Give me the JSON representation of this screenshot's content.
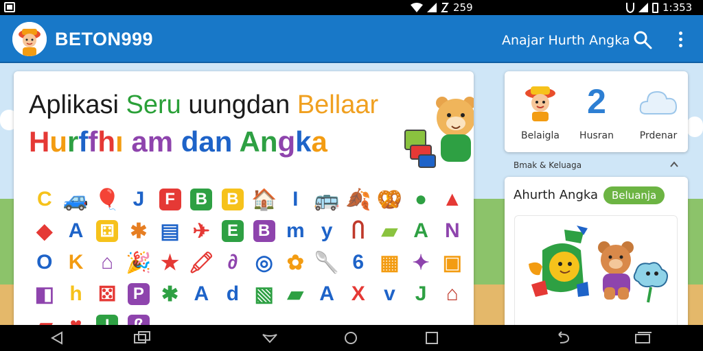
{
  "status_bar": {
    "network_time": "259",
    "clock": "1:353"
  },
  "app_bar": {
    "title": "BETON999",
    "subtitle": "Anajar Hurth Angka",
    "icons": [
      "search-icon",
      "more-vert-icon"
    ]
  },
  "main": {
    "headline_line1": [
      {
        "text": "Aplikasi ",
        "color": "#1b1b1b"
      },
      {
        "text": "Seru ",
        "color": "#2aa038"
      },
      {
        "text": "uungdan ",
        "color": "#1b1b1b"
      },
      {
        "text": "Bellaar",
        "color": "#f0a020"
      }
    ],
    "headline_line2": [
      {
        "text": "H",
        "color": "#e53935"
      },
      {
        "text": "u",
        "color": "#f39c12"
      },
      {
        "text": "r",
        "color": "#2ea043"
      },
      {
        "text": "f",
        "color": "#1e63c8"
      },
      {
        "text": "f",
        "color": "#8e44ad"
      },
      {
        "text": "h",
        "color": "#e53935"
      },
      {
        "text": "ı ",
        "color": "#f39c12"
      },
      {
        "text": "am ",
        "color": "#8e44ad"
      },
      {
        "text": "dan ",
        "color": "#1e63c8"
      },
      {
        "text": "A",
        "color": "#2ea043"
      },
      {
        "text": "n",
        "color": "#2ea043"
      },
      {
        "text": "g",
        "color": "#8e44ad"
      },
      {
        "text": "k",
        "color": "#1e63c8"
      },
      {
        "text": "a",
        "color": "#f39c12"
      }
    ],
    "grid_items": [
      {
        "t": "C",
        "k": "letter",
        "c": "#f6c21b",
        "n": "letter-c"
      },
      {
        "t": "🚙",
        "k": "sym",
        "c": "#1e63c8",
        "n": "car-icon"
      },
      {
        "t": "🎈",
        "k": "sym",
        "c": "#e53935",
        "n": "balloon-icon"
      },
      {
        "t": "J",
        "k": "letter",
        "c": "#1e63c8",
        "n": "letter-j"
      },
      {
        "t": "F",
        "k": "tile",
        "c": "#e53935",
        "n": "letter-f-block"
      },
      {
        "t": "B",
        "k": "tile",
        "c": "#2ea043",
        "n": "letter-b-block"
      },
      {
        "t": "B",
        "k": "tile",
        "c": "#f6c21b",
        "n": "letter-b-block"
      },
      {
        "t": "🏠",
        "k": "sym",
        "c": "#c0392b",
        "n": "house-icon"
      },
      {
        "t": "I",
        "k": "letter",
        "c": "#1e63c8",
        "n": "letter-i"
      },
      {
        "t": "🚌",
        "k": "sym",
        "c": "#f39c12",
        "n": "bus-icon"
      },
      {
        "t": "🍂",
        "k": "sym",
        "c": "#f39c12",
        "n": "hat-icon"
      },
      {
        "t": "🥨",
        "k": "sym",
        "c": "#f6c21b",
        "n": "pretzel-icon"
      },
      {
        "t": "●",
        "k": "sym",
        "c": "#2ea043",
        "n": "ball-icon"
      },
      {
        "t": "▲",
        "k": "sym",
        "c": "#e53935",
        "n": "arrow-icon"
      },
      {
        "t": "◆",
        "k": "sym",
        "c": "#e53935",
        "n": "kite-icon"
      },
      {
        "t": "A",
        "k": "letter",
        "c": "#1e63c8",
        "n": "letter-a"
      },
      {
        "t": "⚃",
        "k": "tile",
        "c": "#f6c21b",
        "n": "dice-icon"
      },
      {
        "t": "✱",
        "k": "sym",
        "c": "#e67e22",
        "n": "flower-icon"
      },
      {
        "t": "▤",
        "k": "sym",
        "c": "#1e63c8",
        "n": "ruler-icon"
      },
      {
        "t": "✈",
        "k": "sym",
        "c": "#e53935",
        "n": "plane-icon"
      },
      {
        "t": "E",
        "k": "tile",
        "c": "#2ea043",
        "n": "letter-e-block"
      },
      {
        "t": "B",
        "k": "tile",
        "c": "#8e44ad",
        "n": "letter-b-block"
      },
      {
        "t": "m",
        "k": "letter",
        "c": "#1e63c8",
        "n": "letter-m"
      },
      {
        "t": "y",
        "k": "letter",
        "c": "#1e63c8",
        "n": "letter-y"
      },
      {
        "t": "Ⴖ",
        "k": "sym",
        "c": "#c0392b",
        "n": "gate-icon"
      },
      {
        "t": "▰",
        "k": "sym",
        "c": "#8ac33f",
        "n": "ruler-icon"
      },
      {
        "t": "A",
        "k": "letter",
        "c": "#2ea043",
        "n": "letter-a"
      },
      {
        "t": "N",
        "k": "letter",
        "c": "#8e44ad",
        "n": "letter-n"
      },
      {
        "t": "O",
        "k": "letter",
        "c": "#1e63c8",
        "n": "letter-o"
      },
      {
        "t": "K",
        "k": "letter",
        "c": "#f39c12",
        "n": "letter-k"
      },
      {
        "t": "⌂",
        "k": "sym",
        "c": "#8e44ad",
        "n": "house-icon"
      },
      {
        "t": "🎉",
        "k": "sym",
        "c": "#e53935",
        "n": "party-icon"
      },
      {
        "t": "★",
        "k": "sym",
        "c": "#e53935",
        "n": "star-icon"
      },
      {
        "t": "🖍",
        "k": "sym",
        "c": "#e53935",
        "n": "crayon-icon"
      },
      {
        "t": "∂",
        "k": "sym",
        "c": "#8e44ad",
        "n": "toy-icon"
      },
      {
        "t": "◎",
        "k": "sym",
        "c": "#1e63c8",
        "n": "target-icon"
      },
      {
        "t": "✿",
        "k": "sym",
        "c": "#f39c12",
        "n": "flower-icon"
      },
      {
        "t": "🥄",
        "k": "sym",
        "c": "#f39c12",
        "n": "spoon-icon"
      },
      {
        "t": "6",
        "k": "letter",
        "c": "#1e63c8",
        "n": "number-6"
      },
      {
        "t": "▦",
        "k": "sym",
        "c": "#f39c12",
        "n": "box-icon"
      },
      {
        "t": "✦",
        "k": "sym",
        "c": "#8e44ad",
        "n": "sparkle-icon"
      },
      {
        "t": "▣",
        "k": "sym",
        "c": "#f39c12",
        "n": "crate-icon"
      },
      {
        "t": "◧",
        "k": "sym",
        "c": "#8e44ad",
        "n": "cube-icon"
      },
      {
        "t": "h",
        "k": "letter",
        "c": "#f6c21b",
        "n": "letter-h"
      },
      {
        "t": "⚄",
        "k": "sym",
        "c": "#e53935",
        "n": "dice-icon"
      },
      {
        "t": "P",
        "k": "tile",
        "c": "#8e44ad",
        "n": "letter-p-block"
      },
      {
        "t": "✱",
        "k": "sym",
        "c": "#2ea043",
        "n": "flower-icon"
      },
      {
        "t": "A",
        "k": "letter",
        "c": "#1e63c8",
        "n": "letter-a"
      },
      {
        "t": "d",
        "k": "letter",
        "c": "#1e63c8",
        "n": "letter-d"
      },
      {
        "t": "▧",
        "k": "sym",
        "c": "#2ea043",
        "n": "toy-box-icon"
      },
      {
        "t": "▰",
        "k": "sym",
        "c": "#2ea043",
        "n": "ruler-icon"
      },
      {
        "t": "A",
        "k": "letter",
        "c": "#1e63c8",
        "n": "letter-a"
      },
      {
        "t": "X",
        "k": "letter",
        "c": "#e53935",
        "n": "letter-x"
      },
      {
        "t": "v",
        "k": "letter",
        "c": "#1e63c8",
        "n": "letter-v"
      },
      {
        "t": "J",
        "k": "letter",
        "c": "#2ea043",
        "n": "letter-j"
      },
      {
        "t": "⌂",
        "k": "sym",
        "c": "#c0392b",
        "n": "house-icon"
      },
      {
        "t": "▰",
        "k": "sym",
        "c": "#e53935",
        "n": "ruler-icon"
      },
      {
        "t": "♥",
        "k": "sym",
        "c": "#e53935",
        "n": "heart-icon"
      },
      {
        "t": "I",
        "k": "tile",
        "c": "#2ea043",
        "n": "letter-i-block"
      },
      {
        "t": "ß",
        "k": "tile",
        "c": "#8e44ad",
        "n": "letter-block"
      }
    ]
  },
  "categories": [
    {
      "label": "Belaigla",
      "icon": "child-icon"
    },
    {
      "label": "Husran",
      "number": "2",
      "icon": "number-two-icon"
    },
    {
      "label": "Prdenar",
      "icon": "cloud-icon"
    }
  ],
  "section_header": {
    "label": "Bmak & Keluaga",
    "icon": "chevron-up-icon"
  },
  "feature": {
    "title": "Ahurth Angka",
    "badge": "Beluanja",
    "image": "toys-bear-illustration"
  },
  "colors": {
    "app_bar": "#1878c8",
    "badge_green": "#6cb443"
  }
}
